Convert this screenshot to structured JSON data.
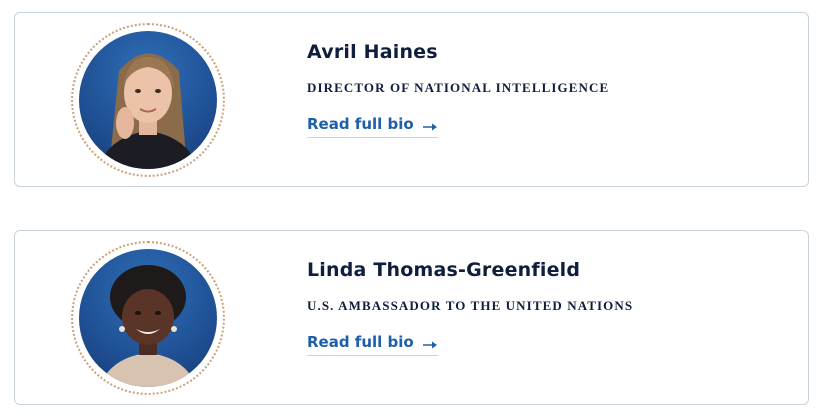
{
  "people": [
    {
      "name": "Avril Haines",
      "title": "DIRECTOR OF NATIONAL INTELLIGENCE",
      "link_label": "Read full bio",
      "link_icon": "arrow-right-icon"
    },
    {
      "name": "Linda Thomas-Greenfield",
      "title": "U.S. AMBASSADOR TO THE UNITED NATIONS",
      "link_label": "Read full bio",
      "link_icon": "arrow-right-icon"
    }
  ],
  "colors": {
    "name_text": "#0f1e3d",
    "link_text": "#1d5fa8",
    "card_border": "#c9d3dc",
    "portrait_frame": "#c9a27a",
    "portrait_background": "#1f4f93"
  }
}
